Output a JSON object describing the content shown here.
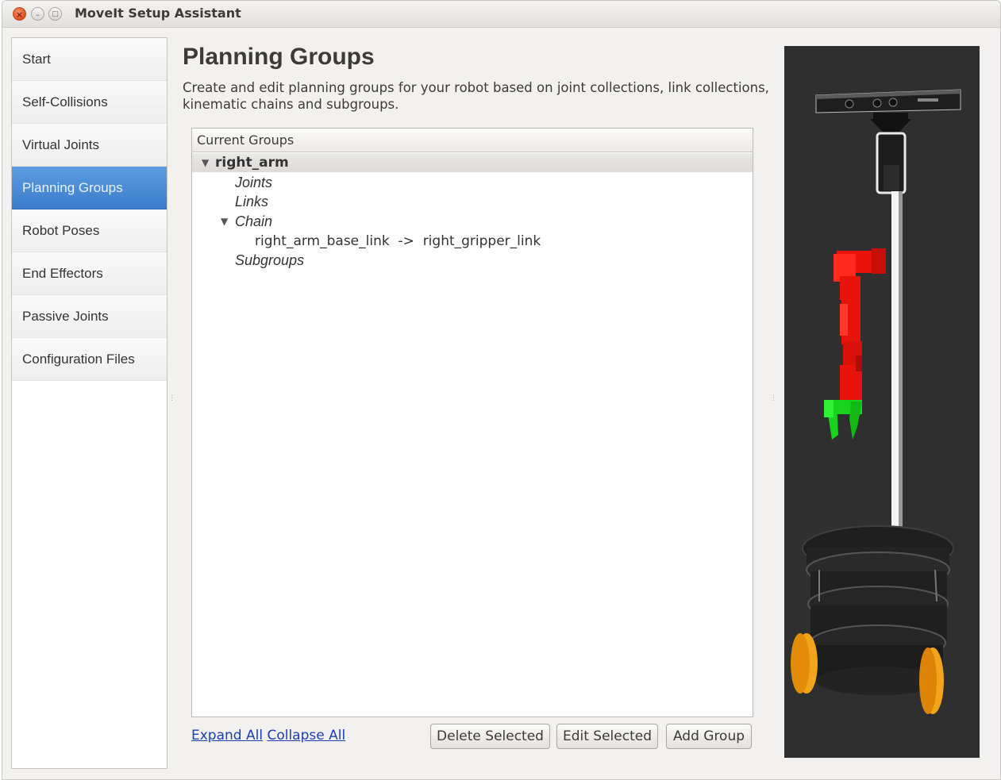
{
  "window": {
    "title": "MoveIt Setup Assistant"
  },
  "sidebar": {
    "items": [
      {
        "label": "Start"
      },
      {
        "label": "Self-Collisions"
      },
      {
        "label": "Virtual Joints"
      },
      {
        "label": "Planning Groups",
        "active": true
      },
      {
        "label": "Robot Poses"
      },
      {
        "label": "End Effectors"
      },
      {
        "label": "Passive Joints"
      },
      {
        "label": "Configuration Files"
      }
    ]
  },
  "main": {
    "title": "Planning Groups",
    "description": "Create and edit planning groups for your robot based on joint collections, link collections, kinematic chains and subgroups.",
    "tree": {
      "header": "Current Groups",
      "group_name": "right_arm",
      "joints_label": "Joints",
      "links_label": "Links",
      "chain_label": "Chain",
      "chain_value": "right_arm_base_link  ->  right_gripper_link",
      "subgroups_label": "Subgroups"
    },
    "links": {
      "expand_all": "Expand All",
      "collapse_all": "Collapse All"
    },
    "buttons": {
      "delete_selected": "Delete Selected",
      "edit_selected": "Edit Selected",
      "add_group": "Add Group"
    }
  },
  "colors": {
    "selected_nav": "#3b7dcb",
    "viewport_bg": "#2f2f2f",
    "arm": "#e8140c",
    "gripper": "#19d41c",
    "wheel": "#f2a51a"
  }
}
